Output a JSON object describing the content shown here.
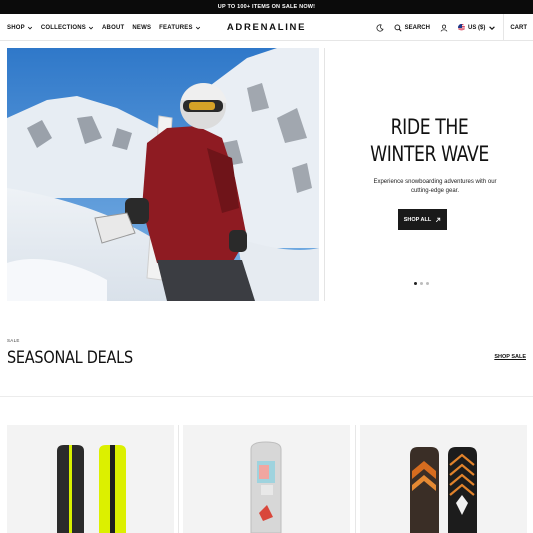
{
  "announcement": "UP TO 100+ ITEMS ON SALE NOW!",
  "header": {
    "logo": "ADRENALINE",
    "nav": [
      {
        "label": "SHOP",
        "dropdown": true
      },
      {
        "label": "COLLECTIONS",
        "dropdown": true
      },
      {
        "label": "ABOUT",
        "dropdown": false
      },
      {
        "label": "NEWS",
        "dropdown": false
      },
      {
        "label": "FEATURES",
        "dropdown": true
      }
    ],
    "search_label": "SEARCH",
    "currency_label": "US ($)",
    "cart_label": "CART",
    "icons": [
      "moon-icon",
      "search-icon",
      "account-icon",
      "us-flag-icon",
      "chevron-down-icon"
    ]
  },
  "hero": {
    "title_line1": "RIDE THE",
    "title_line2": "WINTER WAVE",
    "subtitle_line1": "Experience snowboarding adventures with our",
    "subtitle_line2": "cutting-edge gear.",
    "button_label": "SHOP ALL",
    "slides": 3,
    "active_slide": 1
  },
  "section": {
    "eyebrow": "SALE",
    "title": "SEASONAL DEALS",
    "link_label": "SHOP SALE"
  },
  "products": [
    {
      "name": "black-yellow-snowboards"
    },
    {
      "name": "white-graphic-snowboard"
    },
    {
      "name": "brown-pattern-snowboards"
    }
  ],
  "colors": {
    "announcement_bg": "#0b0b0b",
    "button_bg": "#1a1a1a",
    "card_bg": "#f3f3f3",
    "jacket": "#8e1b22"
  }
}
